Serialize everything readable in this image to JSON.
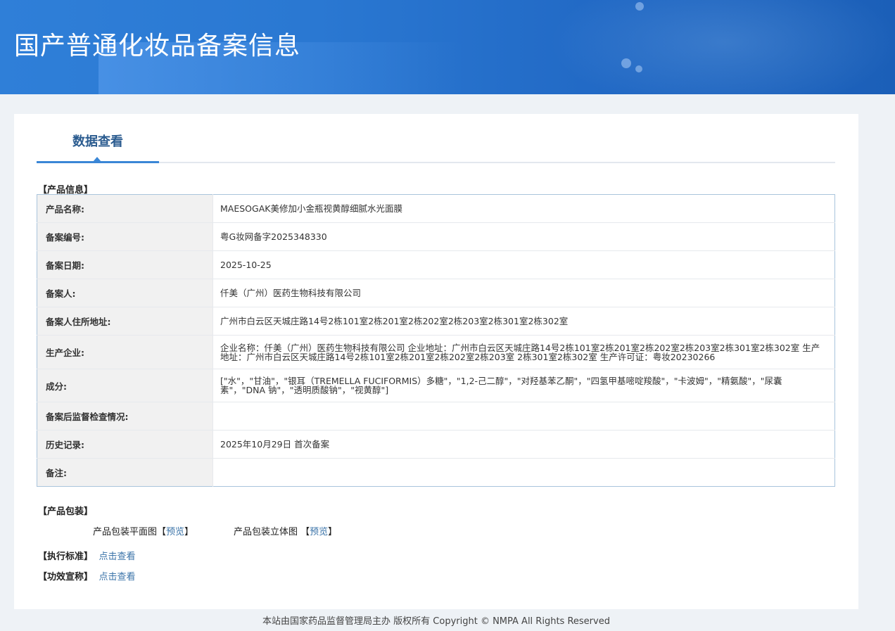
{
  "header": {
    "title": "国产普通化妆品备案信息"
  },
  "tabs": [
    {
      "label": "数据查看",
      "active": true
    }
  ],
  "product_info": {
    "section_label": "【产品信息】",
    "rows": [
      {
        "key": "产品名称:",
        "value": "MAESOGAK美修加小金瓶视黄醇细腻水光面膜"
      },
      {
        "key": "备案编号:",
        "value": "粤G妆网备字2025348330"
      },
      {
        "key": "备案日期:",
        "value": "2025-10-25"
      },
      {
        "key": "备案人:",
        "value": "仟美（广州）医药生物科技有限公司"
      },
      {
        "key": "备案人住所地址:",
        "value": "广州市白云区天城庄路14号2栋101室2栋201室2栋202室2栋203室2栋301室2栋302室"
      },
      {
        "key": "生产企业:",
        "value": "企业名称：仟美（广州）医药生物科技有限公司 企业地址：广州市白云区天城庄路14号2栋101室2栋201室2栋202室2栋203室2栋301室2栋302室 生产地址：广州市白云区天城庄路14号2栋101室2栋201室2栋202室2栋203室 2栋301室2栋302室 生产许可证：粤妆20230266"
      },
      {
        "key": "成分:",
        "value": "[\"水\"，\"甘油\"，\"银耳（TREMELLA FUCIFORMIS）多糖\"，\"1,2-己二醇\"，\"对羟基苯乙酮\"，\"四氢甲基嘧啶羧酸\"，\"卡波姆\"，\"精氨酸\"，\"尿囊素\"，\"DNA 钠\"，\"透明质酸钠\"，\"视黄醇\"]"
      },
      {
        "key": "备案后监督检查情况:",
        "value": ""
      },
      {
        "key": "历史记录:",
        "value": "2025年10月29日 首次备案"
      },
      {
        "key": "备注:",
        "value": ""
      }
    ]
  },
  "packaging": {
    "section_label": "【产品包装】",
    "flat_label": "产品包装平面图",
    "flat_link": "预览",
    "stereo_label": "产品包装立体图",
    "stereo_link": "预览"
  },
  "standard": {
    "label": "【执行标准】",
    "link": "点击查看"
  },
  "efficacy": {
    "label": "【功效宣称】",
    "link": "点击查看"
  },
  "footer": {
    "text": "本站由国家药品监督管理局主办 版权所有 Copyright © NMPA All Rights Reserved"
  }
}
